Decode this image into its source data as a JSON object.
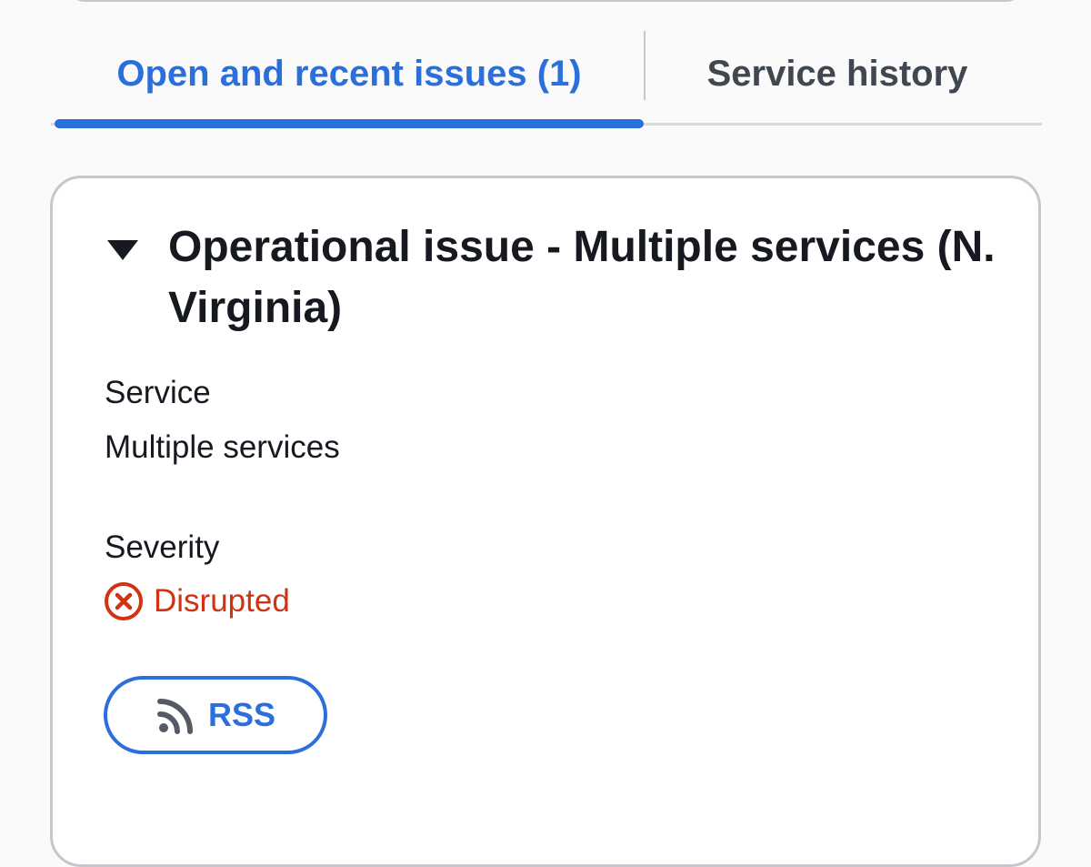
{
  "tabs": [
    {
      "label": "Open and recent issues (1)",
      "active": true
    },
    {
      "label": "Service history",
      "active": false
    }
  ],
  "issue": {
    "expanded": true,
    "title": "Operational issue - Multiple services (N. Virginia)",
    "service_label": "Service",
    "service_value": "Multiple services",
    "severity_label": "Severity",
    "severity_value": "Disrupted",
    "severity_icon": "error-circle-icon",
    "rss_label": "RSS",
    "rss_icon": "rss-icon"
  },
  "colors": {
    "accent": "#2a6fdb",
    "severity_error": "#d13212",
    "text_primary": "#16191f",
    "text_secondary": "#414750",
    "border": "#c6c6cd"
  }
}
